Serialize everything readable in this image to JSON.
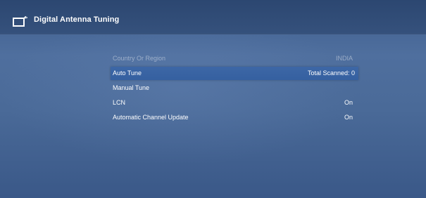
{
  "header": {
    "title": "Digital Antenna Tuning",
    "icon": "tv-antenna-icon"
  },
  "menu": {
    "items": [
      {
        "label": "Country Or Region",
        "value": "INDIA",
        "state": "disabled"
      },
      {
        "label": "Auto Tune",
        "value": "Total Scanned: 0",
        "state": "selected"
      },
      {
        "label": "Manual Tune",
        "value": "",
        "state": "normal"
      },
      {
        "label": "LCN",
        "value": "On",
        "state": "normal"
      },
      {
        "label": "Automatic Channel Update",
        "value": "On",
        "state": "normal"
      }
    ]
  },
  "colors": {
    "background": "#4a6a98",
    "header": "#2f4a75",
    "selected_row": "#3863a3",
    "disabled_text": "#9fb0c8"
  }
}
